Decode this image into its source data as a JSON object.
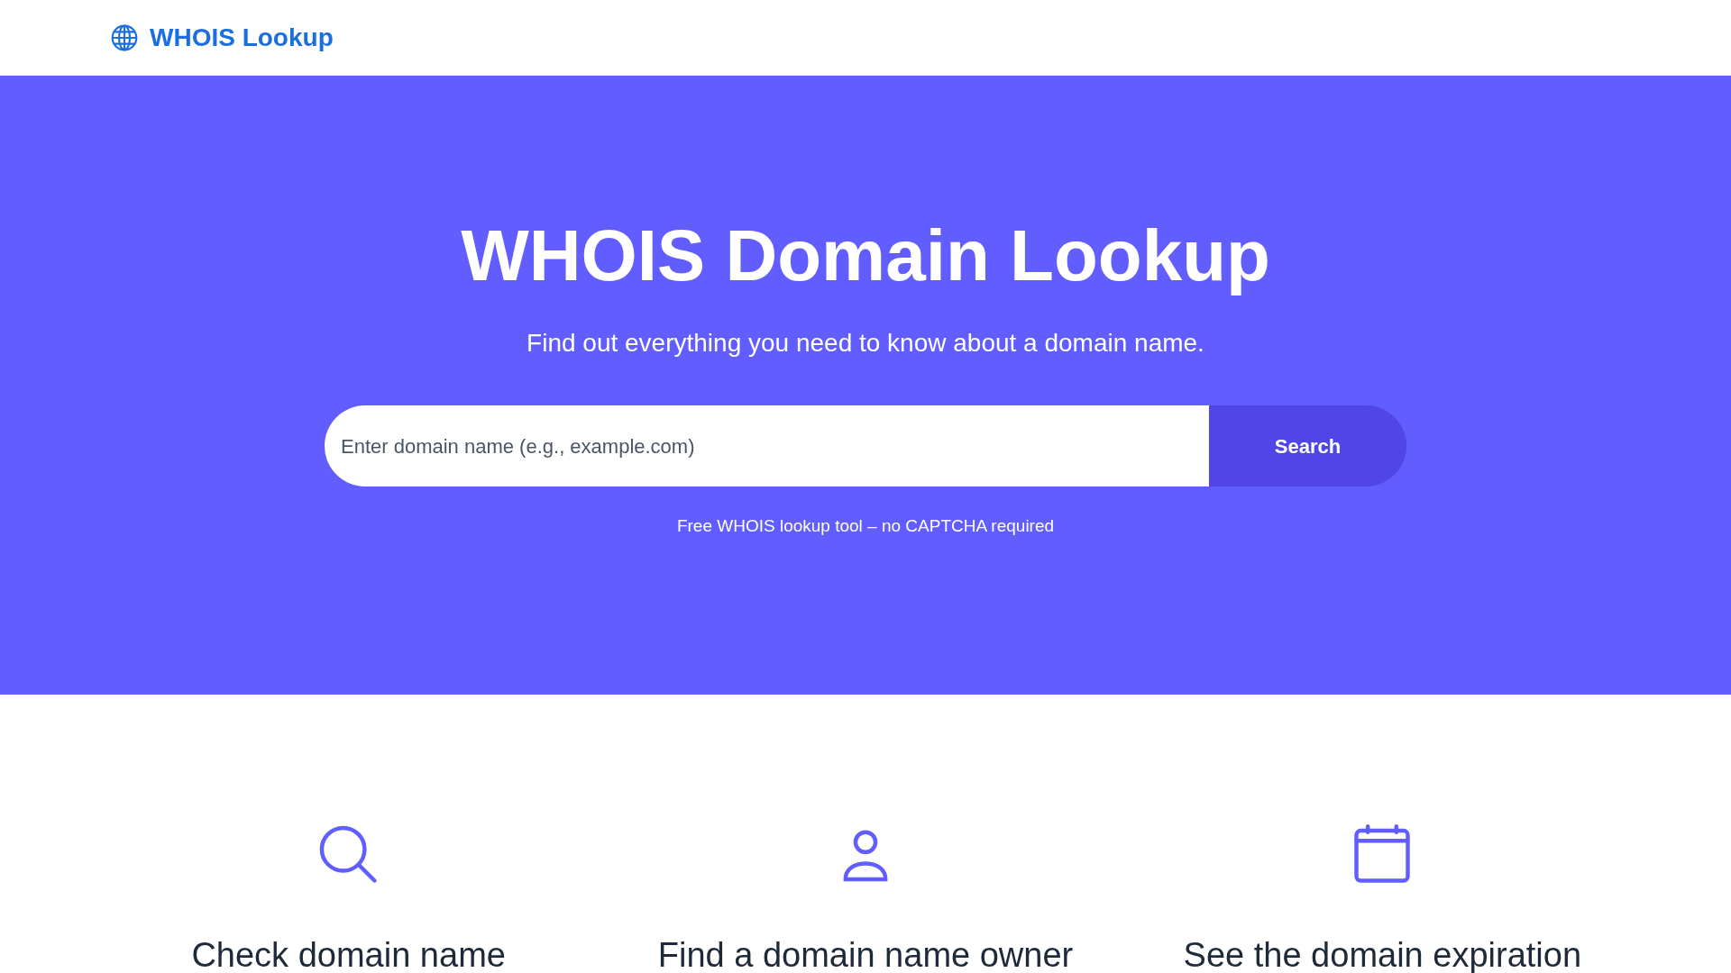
{
  "header": {
    "logo": "WHOIS Lookup"
  },
  "hero": {
    "title": "WHOIS Domain Lookup",
    "subtitle": "Find out everything you need to know about a domain name.",
    "search": {
      "placeholder": "Enter domain name (e.g., example.com)",
      "button": "Search"
    },
    "note": "Free WHOIS lookup tool – no CAPTCHA required"
  },
  "features": [
    {
      "kind": "search",
      "title": "Check domain name"
    },
    {
      "kind": "person",
      "title": "Find a domain name owner"
    },
    {
      "kind": "calendar",
      "title": "See the domain expiration"
    }
  ]
}
